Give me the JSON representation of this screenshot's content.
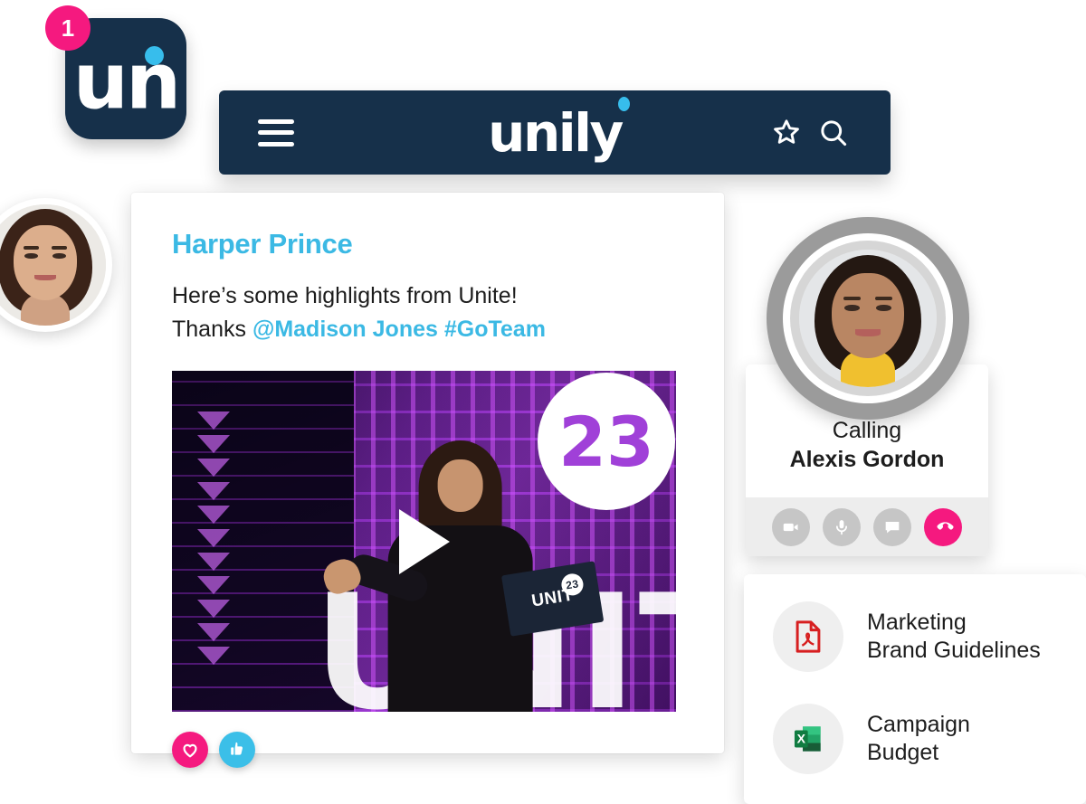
{
  "app_icon": {
    "badge_count": "1",
    "logo_text": "un",
    "dot_icon": "cyan-dot-icon",
    "brand_navy": "#16304a",
    "brand_pink": "#f5197f",
    "brand_cyan": "#37bdec"
  },
  "navbar": {
    "menu_icon": "hamburger-menu-icon",
    "logo_text": "unily",
    "favorites_icon": "star-outline-icon",
    "search_icon": "search-icon",
    "background": "#16304a"
  },
  "post": {
    "author": "Harper Prince",
    "body_line1": "Here’s some highlights from Unite!",
    "body_line2_prefix": "Thanks ",
    "mention": "@Madison Jones",
    "hashtag": "#GoTeam",
    "author_color": "#3bb9e4",
    "media": {
      "play_icon": "play-triangle-icon",
      "year_badge": "23",
      "backdrop_word": "UNITE",
      "sign_text": "UNIT",
      "sign_badge": "23"
    },
    "reactions": [
      {
        "name": "heart-reaction",
        "icon": "heart-icon",
        "color": "#f5197f"
      },
      {
        "name": "like-reaction",
        "icon": "thumbs-up-icon",
        "color": "#3bbfe8"
      }
    ]
  },
  "left_avatar": {
    "name": "user-avatar",
    "icon": "avatar-photo"
  },
  "calling_card": {
    "status_label": "Calling",
    "caller_name": "Alexis Gordon",
    "avatar_icon": "caller-avatar-photo",
    "actions": [
      {
        "name": "video-call-button",
        "icon": "video-camera-icon",
        "color": "#c6c6c6"
      },
      {
        "name": "mute-button",
        "icon": "microphone-icon",
        "color": "#c6c6c6"
      },
      {
        "name": "chat-button",
        "icon": "chat-bubble-icon",
        "color": "#c6c6c6"
      },
      {
        "name": "end-call-button",
        "icon": "phone-hangup-icon",
        "color": "#f5197f"
      }
    ]
  },
  "files_card": {
    "items": [
      {
        "name_line1": "Marketing",
        "name_line2": "Brand Guidelines",
        "icon": "pdf-file-icon",
        "icon_color": "#d71f20"
      },
      {
        "name_line1": "Campaign",
        "name_line2": "Budget",
        "icon": "excel-file-icon",
        "icon_color": "#1d7044"
      }
    ]
  }
}
